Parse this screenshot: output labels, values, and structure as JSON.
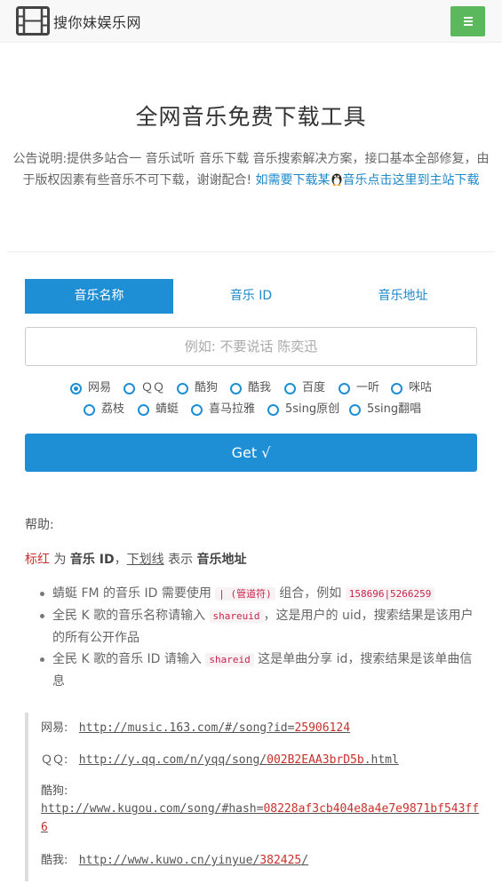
{
  "header": {
    "brand": "搜你妹娱乐网",
    "logo_icon": "film-strip-icon",
    "menu_icon": "hamburger-menu-icon"
  },
  "main": {
    "title": "全网音乐免费下载工具",
    "notice_text": "公告说明:提供多站合一 音乐试听 音乐下载 音乐搜索解决方案，接口基本全部修复，由于版权因素有些音乐不可下载，谢谢配合! ",
    "notice_link_a": "如需要下载某",
    "notice_link_b": "音乐点击这里到主站下载"
  },
  "tabs": [
    {
      "label": "音乐名称",
      "active": true
    },
    {
      "label": "音乐 ID",
      "active": false
    },
    {
      "label": "音乐地址",
      "active": false
    }
  ],
  "search": {
    "placeholder": "例如: 不要说话 陈奕迅",
    "value": ""
  },
  "sources": [
    {
      "label": "网易",
      "selected": true
    },
    {
      "label": "ＱＱ",
      "selected": false
    },
    {
      "label": "酷狗",
      "selected": false
    },
    {
      "label": "酷我",
      "selected": false
    },
    {
      "label": "百度",
      "selected": false
    },
    {
      "label": "一听",
      "selected": false
    },
    {
      "label": "咪咕",
      "selected": false
    },
    {
      "label": "荔枝",
      "selected": false
    },
    {
      "label": "蜻蜓",
      "selected": false
    },
    {
      "label": "喜马拉雅",
      "selected": false
    },
    {
      "label": "5sing原创",
      "selected": false
    },
    {
      "label": "5sing翻唱",
      "selected": false
    }
  ],
  "get_button": "Get √",
  "help": {
    "title": "帮助:",
    "legend_red": "标红",
    "legend_is": " 为 ",
    "legend_music_id": "音乐 ID",
    "legend_comma": "，",
    "legend_underline": "下划线",
    "legend_means": " 表示 ",
    "legend_music_url": "音乐地址",
    "tip1_a": "蜻蜓 FM 的音乐 ID 需要使用 ",
    "tip1_code1": "| (管道符)",
    "tip1_b": " 组合，例如 ",
    "tip1_code2": "158696|5266259",
    "tip2_a": "全民 K 歌的音乐名称请输入 ",
    "tip2_code": "shareuid",
    "tip2_b": "，这是用户的 uid，搜索结果是该用户的所有公开作品",
    "tip3_a": "全民 K 歌的音乐 ID 请输入 ",
    "tip3_code": "shareid",
    "tip3_b": " 这是单曲分享 id，搜索结果是该单曲信息"
  },
  "examples": [
    {
      "site": "网易:",
      "url_prefix": "http://music.163.com/#/song?id=",
      "id": "25906124",
      "url_suffix": ""
    },
    {
      "site": "ＱＱ:",
      "url_prefix": "http://y.qq.com/n/yqq/song/",
      "id": "002B2EAA3brD5b",
      "url_suffix": ".html"
    },
    {
      "site": "酷狗:",
      "url_prefix": "http://www.kugou.com/song/#hash=",
      "id": "08228af3cb404e8a4e7e9871bf543ff6",
      "url_suffix": ""
    },
    {
      "site": "酷我:",
      "url_prefix": "http://www.kuwo.cn/yinyue/",
      "id": "382425",
      "url_suffix": "/"
    }
  ],
  "colors": {
    "primary": "#1e8fd5",
    "menu_button": "#5cb85c",
    "highlight_red": "#c9302c",
    "code_text": "#c7254e"
  }
}
